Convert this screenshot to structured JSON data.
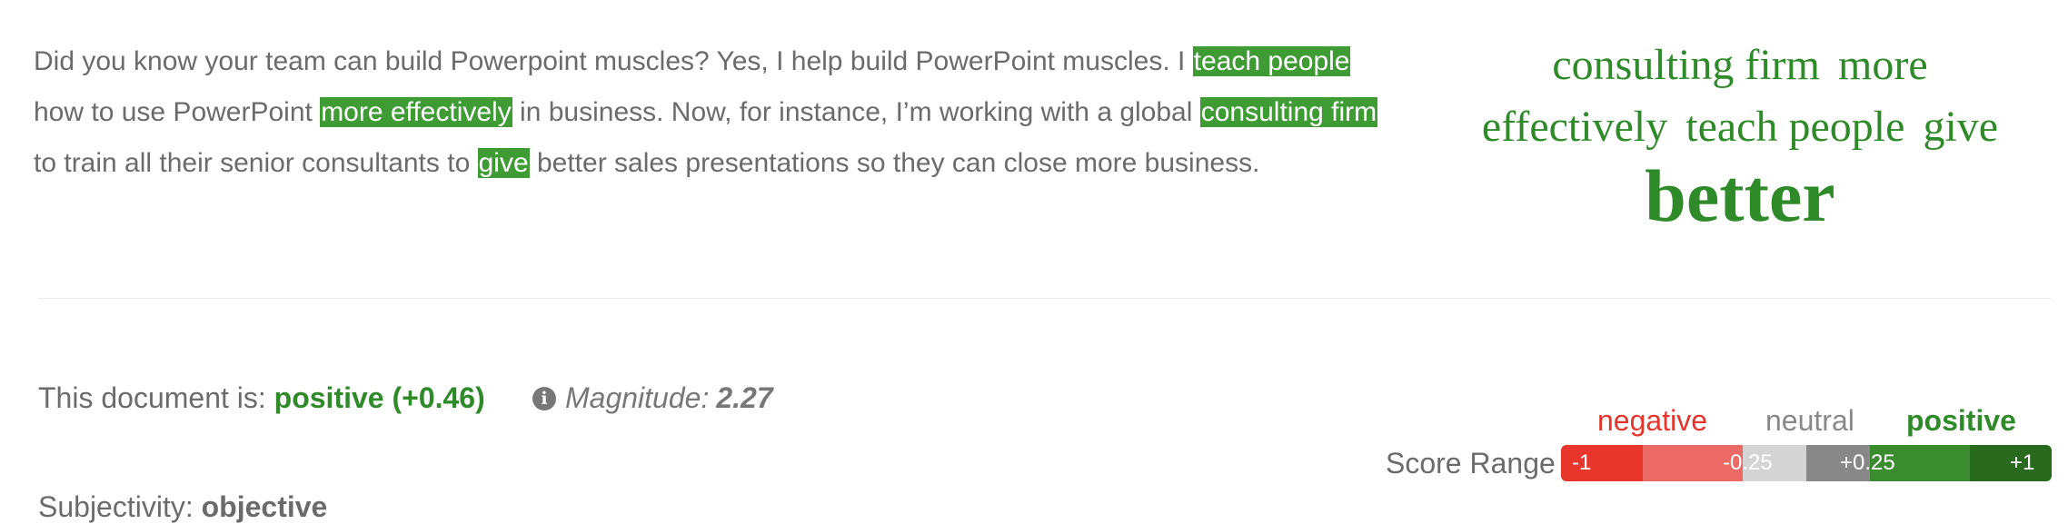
{
  "passage": {
    "t1": "Did you know your team can build Powerpoint muscles? Yes, I help build PowerPoint muscles. I ",
    "h1": "teach people",
    "t2": " how to use PowerPoint ",
    "h2": "more effectively",
    "t3": " in business. Now, for instance, I’m working with a global ",
    "h3": "consulting firm",
    "t4": " to train all their senior consultants to ",
    "h4": "give",
    "t5": " better sales presentations so they can close more business."
  },
  "cloud": {
    "words": [
      "consulting firm",
      "more",
      "effectively",
      "teach people",
      "give",
      "better"
    ]
  },
  "document": {
    "prefix": "This document is: ",
    "sentiment": "positive",
    "score": "(+0.46)",
    "magnitude_label": "Magnitude:",
    "magnitude_value": "2.27",
    "info_icon": "info-icon",
    "subjectivity_label": "Subjectivity:",
    "subjectivity_value": "objective"
  },
  "score_range": {
    "title": "Score Range",
    "negative": "negative",
    "neutral": "neutral",
    "positive": "positive",
    "ticks": [
      "-1",
      "-0.25",
      "+0.25",
      "+1"
    ],
    "colors": {
      "strong_negative": "#e8362d",
      "negative": "#ec6a66",
      "neutral": "#d4d4d4",
      "neutral_dark": "#888888",
      "positive": "#3a8c2e",
      "strong_positive": "#296a1f"
    }
  }
}
